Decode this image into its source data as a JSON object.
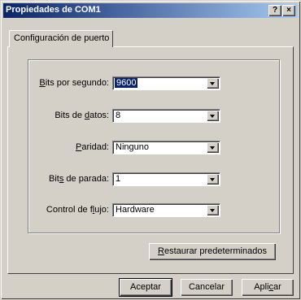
{
  "window": {
    "title": "Propiedades de COM1",
    "help_button": "?",
    "close_button": "×"
  },
  "tabs": [
    {
      "label": "Configuración de puerto"
    }
  ],
  "settings": {
    "bits_por_segundo": {
      "label_pre": "",
      "label_underline": "B",
      "label_post": "its por segundo:",
      "value": "9600"
    },
    "bits_de_datos": {
      "label_pre": "Bits de ",
      "label_underline": "d",
      "label_post": "atos:",
      "value": "8"
    },
    "paridad": {
      "label_pre": "",
      "label_underline": "P",
      "label_post": "aridad:",
      "value": "Ninguno"
    },
    "bits_de_parada": {
      "label_pre": "Bit",
      "label_underline": "s",
      "label_post": " de parada:",
      "value": "1"
    },
    "control_de_flujo": {
      "label_pre": "Control de f",
      "label_underline": "l",
      "label_post": "ujo:",
      "value": "Hardware"
    }
  },
  "restore_button": {
    "underline": "R",
    "rest": "estaurar predeterminados"
  },
  "footer": {
    "accept_label": "Aceptar",
    "cancel_label": "Cancelar",
    "apply_pre": "Apli",
    "apply_underline": "c",
    "apply_post": "ar"
  },
  "colors": {
    "titlebar_start": "#0a246a",
    "titlebar_end": "#a6caf0",
    "face": "#d4d0c8",
    "selection": "#0a246a"
  }
}
